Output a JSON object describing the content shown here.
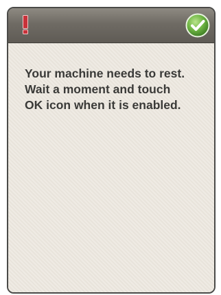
{
  "dialog": {
    "alert_icon": "exclamation-icon",
    "ok_icon": "checkmark-icon",
    "message": "Your machine needs to rest.\nWait a moment and touch\nOK icon when it is enabled."
  },
  "colors": {
    "title_bar": "#6f6b64",
    "alert_red": "#c8323a",
    "ok_green": "#5fa53a",
    "background": "#ece7de",
    "text": "#3a3a38"
  }
}
